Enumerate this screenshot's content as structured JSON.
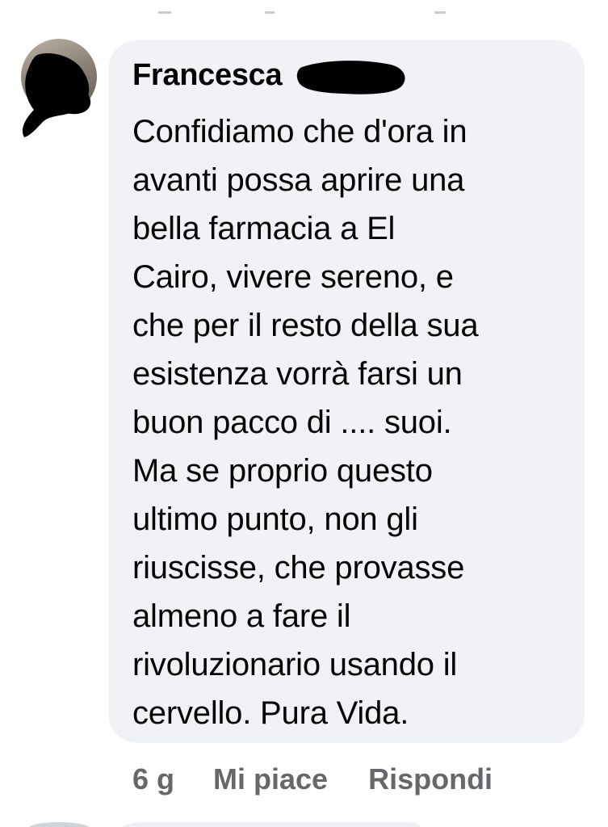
{
  "comment": {
    "author": "Francesca",
    "text": "Confidiamo che d'ora in\navanti possa aprire una\nbella farmacia a El\nCairo, vivere sereno, e\nche per il resto della sua\nesistenza vorrà farsi un\nbuon pacco di .... suoi.\nMa se proprio questo\nultimo punto, non gli\nriuscisse, che provasse\nalmeno a fare il\nrivoluzionario usando il\ncervello. Pura Vida.",
    "time": "6 g",
    "like_label": "Mi piace",
    "reply_label": "Rispondi"
  },
  "colors": {
    "bubble_background": "#f0f2f5",
    "text": "#050505",
    "action_text": "#65676b"
  },
  "icons": {
    "avatar": "avatar",
    "redaction": "redaction-mark"
  }
}
